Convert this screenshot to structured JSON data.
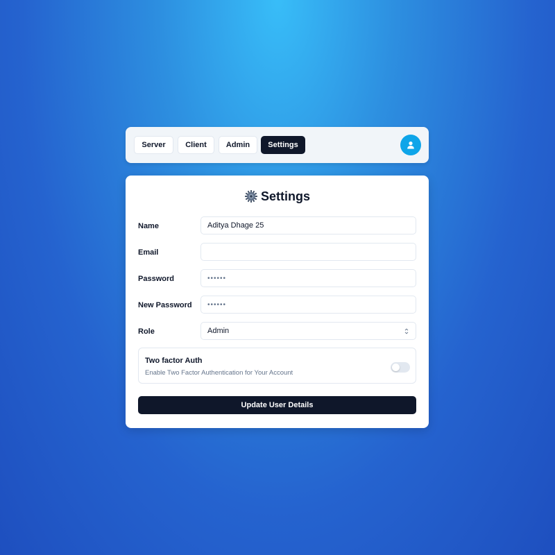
{
  "nav": {
    "tabs": [
      {
        "label": "Server",
        "active": false
      },
      {
        "label": "Client",
        "active": false
      },
      {
        "label": "Admin",
        "active": false
      },
      {
        "label": "Settings",
        "active": true
      }
    ],
    "avatar_icon": "user-icon"
  },
  "settings": {
    "title": "Settings",
    "title_icon": "gear-icon",
    "fields": {
      "name": {
        "label": "Name",
        "value": "Aditya Dhage 25"
      },
      "email": {
        "label": "Email",
        "value": ""
      },
      "password": {
        "label": "Password",
        "value": "••••••"
      },
      "new_password": {
        "label": "New Password",
        "value": "••••••"
      },
      "role": {
        "label": "Role",
        "value": "Admin"
      }
    },
    "two_factor": {
      "title": "Two factor Auth",
      "description": "Enable Two Factor Authentication for Your Account",
      "enabled": false
    },
    "submit_label": "Update User Details"
  },
  "colors": {
    "primary": "#0f172a",
    "accent": "#0ea5e9",
    "muted": "#64748b",
    "border": "#e2e8f0"
  }
}
